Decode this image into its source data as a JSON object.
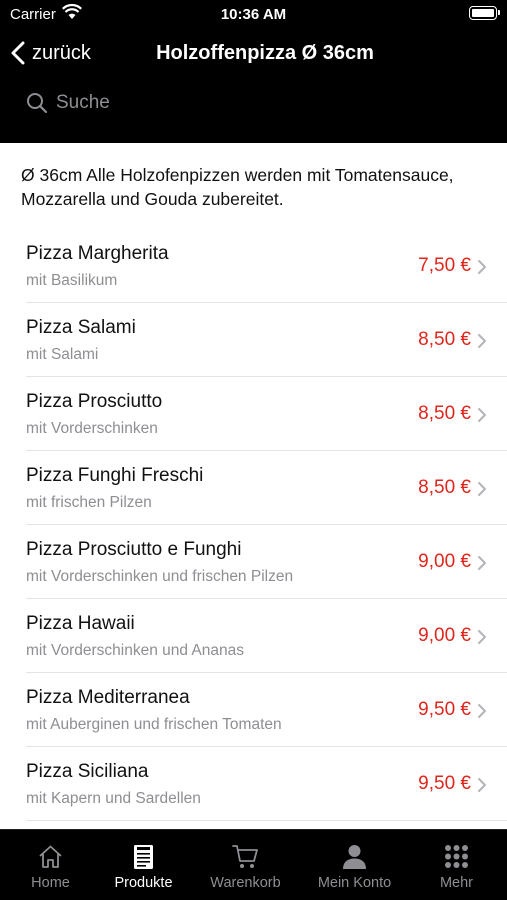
{
  "status_bar": {
    "carrier": "Carrier",
    "time": "10:36 AM"
  },
  "nav": {
    "back_label": "zurück",
    "title": "Holzoffenpizza Ø 36cm"
  },
  "search": {
    "placeholder": "Suche"
  },
  "category": {
    "description": "Ø 36cm Alle Holzofenpizzen werden mit Tomatensauce, Mozzarella und Gouda zubereitet."
  },
  "items": [
    {
      "name": "Pizza Margherita",
      "description": "mit Basilikum",
      "price": "7,50 €"
    },
    {
      "name": "Pizza Salami",
      "description": "mit Salami",
      "price": "8,50 €"
    },
    {
      "name": "Pizza Prosciutto",
      "description": "mit Vorderschinken",
      "price": "8,50 €"
    },
    {
      "name": "Pizza Funghi Freschi",
      "description": "mit frischen Pilzen",
      "price": "8,50 €"
    },
    {
      "name": "Pizza Prosciutto e Funghi",
      "description": "mit Vorderschinken und frischen Pilzen",
      "price": "9,00 €"
    },
    {
      "name": "Pizza Hawaii",
      "description": "mit Vorderschinken und Ananas",
      "price": "9,00 €"
    },
    {
      "name": "Pizza Mediterranea",
      "description": "mit Auberginen und frischen Tomaten",
      "price": "9,50 €"
    },
    {
      "name": "Pizza Siciliana",
      "description": "mit Kapern und Sardellen",
      "price": "9,50 €"
    }
  ],
  "tabs": [
    {
      "label": "Home",
      "icon": "home-icon",
      "active": false
    },
    {
      "label": "Produkte",
      "icon": "menu-card-icon",
      "active": true
    },
    {
      "label": "Warenkorb",
      "icon": "cart-icon",
      "active": false
    },
    {
      "label": "Mein Konto",
      "icon": "person-icon",
      "active": false
    },
    {
      "label": "Mehr",
      "icon": "grid-dots-icon",
      "active": false
    }
  ],
  "colors": {
    "price": "#e0261c",
    "background_dark": "#000000",
    "tab_inactive": "#8e8e93",
    "tab_active": "#ffffff"
  }
}
